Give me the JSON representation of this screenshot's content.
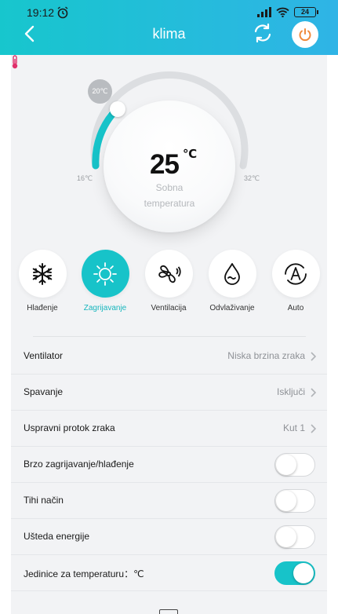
{
  "status": {
    "time": "19:12",
    "battery": "24"
  },
  "header": {
    "title": "klima"
  },
  "dial": {
    "setpoint_badge": "20℃",
    "temperature": "25",
    "unit": "℃",
    "label_line1": "Sobna",
    "label_line2": "temperatura",
    "min_label": "16℃",
    "max_label": "32℃"
  },
  "modes": [
    {
      "label": "Hlađenje",
      "icon": "snowflake-icon"
    },
    {
      "label": "Zagrijavanje",
      "icon": "sun-icon",
      "active": true
    },
    {
      "label": "Ventilacija",
      "icon": "fan-icon"
    },
    {
      "label": "Odvlaživanje",
      "icon": "droplet-icon"
    },
    {
      "label": "Auto",
      "icon": "auto-icon"
    }
  ],
  "settings": [
    {
      "label": "Ventilator",
      "value": "Niska brzina zraka"
    },
    {
      "label": "Spavanje",
      "value": "Isključi"
    },
    {
      "label": "Uspravni protok zraka",
      "value": "Kut 1"
    },
    {
      "label": "Brzo zagrijavanje/hlađenje",
      "toggle": false
    },
    {
      "label": "Tihi način",
      "toggle": false
    },
    {
      "label": "Ušteda energije",
      "toggle": false
    },
    {
      "label": "Jedinice za temperaturu：℃",
      "toggle": true
    }
  ],
  "colors": {
    "accent": "#17c3c9",
    "header_start": "#17c6cd",
    "header_end": "#2fb4e6",
    "power": "#f08a3c"
  }
}
